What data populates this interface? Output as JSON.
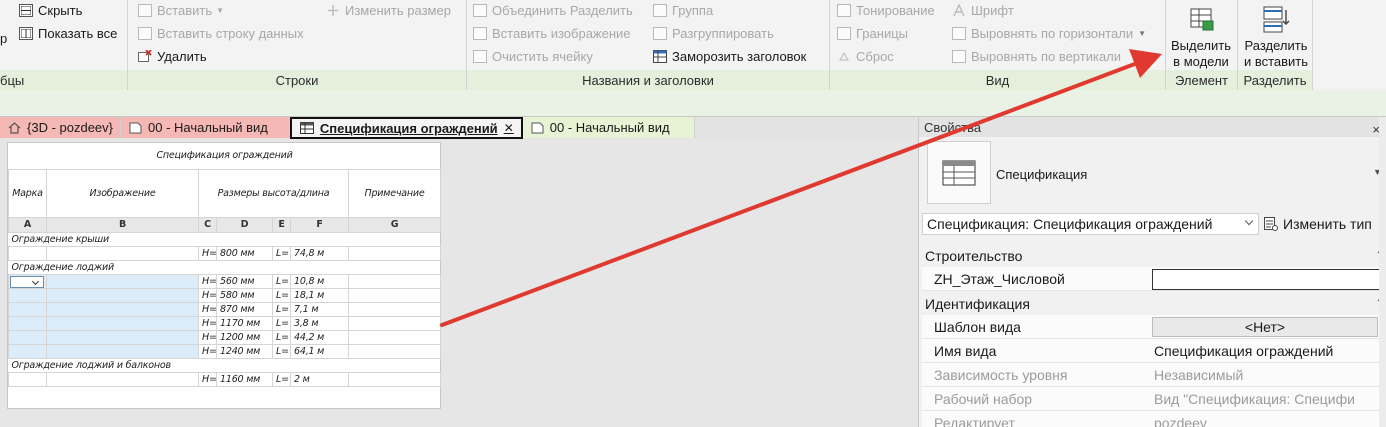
{
  "ribbon": {
    "col1": {
      "partial_top": "р",
      "hide": "Скрыть",
      "show_all": "Показать все",
      "group_label": "бцы"
    },
    "rows": {
      "insert": "Вставить",
      "insert_data_row": "Вставить строку данных",
      "delete": "Удалить",
      "resize": "Изменить размер",
      "group_label": "Строки"
    },
    "titles": {
      "merge_unmerge": "Объединить Разделить",
      "insert_image": "Вставить изображение",
      "clear_cell": "Очистить ячейку",
      "group": "Группа",
      "ungroup": "Разгруппировать",
      "freeze_header": "Заморозить заголовок",
      "group_label": "Названия и заголовки"
    },
    "view": {
      "shading": "Тонирование",
      "borders": "Границы",
      "reset": "Сброс",
      "font": "Шрифт",
      "align_horizontal": "Выровнять по горизонтали",
      "align_vertical": "Выровнять по вертикали",
      "group_label": "Вид"
    },
    "element": {
      "highlight_l1": "Выделить",
      "highlight_l2": "в модели",
      "group_label": "Элемент"
    },
    "split": {
      "split_l1": "Разделить",
      "split_l2": "и вставить",
      "group_label": "Разделить"
    }
  },
  "tabs": [
    {
      "label": "{3D - pozdeev}",
      "icon": "house-icon"
    },
    {
      "label": "00 - Начальный вид",
      "icon": "sheet-icon"
    },
    {
      "label": "Спецификация ограждений",
      "icon": "table-icon",
      "active": true
    },
    {
      "label": "00 - Начальный вид",
      "icon": "sheet-icon"
    }
  ],
  "schedule": {
    "title": "Спецификация ограждений",
    "headers": {
      "mark": "Марка",
      "image": "Изображение",
      "sizes": "Размеры высота/длина",
      "note": "Примечание"
    },
    "letters": [
      "A",
      "B",
      "C",
      "D",
      "E",
      "F",
      "G"
    ],
    "groups": [
      {
        "name": "Ограждение крыши",
        "rows": [
          {
            "h": "800 мм",
            "l": "74,8 м"
          }
        ]
      },
      {
        "name": "Ограждение лоджий",
        "rows": [
          {
            "h": "560 мм",
            "l": "10,8 м"
          },
          {
            "h": "580 мм",
            "l": "18,1 м"
          },
          {
            "h": "870 мм",
            "l": "7,1 м"
          },
          {
            "h": "1170 мм",
            "l": "3,8 м"
          },
          {
            "h": "1200 мм",
            "l": "44,2 м"
          },
          {
            "h": "1240 мм",
            "l": "64,1 м"
          }
        ]
      },
      {
        "name": "Ограждение лоджий и балконов",
        "rows": [
          {
            "h": "1160 мм",
            "l": "2 м"
          }
        ]
      }
    ],
    "h_prefix": "H=",
    "l_prefix": "L="
  },
  "properties": {
    "panel_title": "Свойства",
    "close_glyph": "×",
    "type_name": "Спецификация",
    "type_dropdown_glyph": "▼",
    "filter_value": "Спецификация: Спецификация ограждений",
    "edit_type": "Изменить тип",
    "sections": [
      {
        "label": "Строительство",
        "collapse_glyph": "⌃"
      },
      {
        "label": "Идентификация",
        "collapse_glyph": "⌃"
      }
    ],
    "params": [
      {
        "label": "ZH_Этаж_Числовой",
        "value": ""
      },
      {
        "label": "Шаблон вида",
        "value": "<Нет>"
      },
      {
        "label": "Имя вида",
        "value": "Спецификация ограждений"
      },
      {
        "label": "Зависимость уровня",
        "value": "Независимый"
      },
      {
        "label": "Рабочий набор",
        "value": "Вид \"Спецификация: Специфи"
      },
      {
        "label": "Редактирует",
        "value": "pozdeev"
      }
    ]
  },
  "colors": {
    "arrow": "#e03a30",
    "tab_pink": "#f6b8b4",
    "tab_green": "#e8f2d4",
    "ribbon_group": "#e4efdc"
  }
}
